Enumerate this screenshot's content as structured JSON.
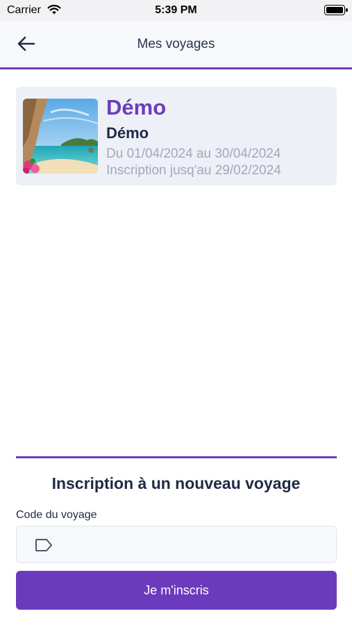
{
  "status_bar": {
    "carrier": "Carrier",
    "time": "5:39 PM"
  },
  "header": {
    "title": "Mes voyages",
    "back_icon": "arrow-left-icon"
  },
  "trips": [
    {
      "title": "Démo",
      "subtitle": "Démo",
      "dates": "Du 01/04/2024 au 30/04/2024",
      "deadline": "Inscription jusq'au 29/02/2024",
      "image": "beach-cove-photo"
    }
  ],
  "registration": {
    "title": "Inscription à un nouveau voyage",
    "code_label": "Code du voyage",
    "code_value": "",
    "code_placeholder": "",
    "code_icon": "tag-icon",
    "submit_label": "Je m'inscris"
  },
  "colors": {
    "accent": "#6c3bbd",
    "card_bg": "#edf0f6",
    "muted_text": "#a3a8bb",
    "dark_text": "#1f2a44"
  }
}
